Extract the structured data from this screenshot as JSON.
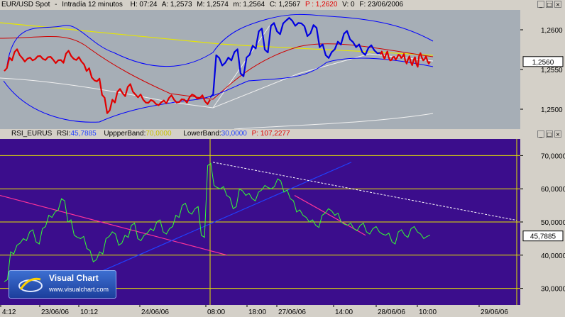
{
  "price_header": {
    "symbol": "EUR/USD Spot",
    "sep1": " - ",
    "interval": "Intradía 12 minutos",
    "H": "H: 07:24",
    "A": "A: 1,2573",
    "M": "M: 1,2574",
    "m": "m: 1,2564",
    "C": "C: 1,2567",
    "P": "P : 1,2620",
    "V": "V: 0",
    "F": "F: 23/06/2006"
  },
  "rsi_header": {
    "name": "RSI_EURUS",
    "rsi_label": "RSI:",
    "rsi_value": "45,7885",
    "upper_label": "UppperBand:",
    "upper_value": "70,0000",
    "lower_label": "LowerBand:",
    "lower_value": "30,0000",
    "p_label": "P: 107,2277"
  },
  "window_buttons": [
    "_",
    "□",
    "×"
  ],
  "colors": {
    "price_bg": "#a6aeb6",
    "rsi_bg": "#3b0d8c",
    "price_red": "#e00000",
    "price_blue": "#0000e0",
    "bollinger": "#0000ff",
    "ma_red": "#d00000",
    "ma_yellow": "#e6e600",
    "rsi_line": "#33ff33",
    "band_yellow": "#e6e600",
    "trend_pink": "#ff3399",
    "trend_blue": "#2040ff",
    "trend_white": "#ffffff"
  },
  "chart_data": [
    {
      "type": "line",
      "ylim": [
        1.2475,
        1.2625
      ],
      "y_ticks": [
        "1,2600",
        "1,2550",
        "1,2500"
      ],
      "last_value_label": "1,2560",
      "last_value": 1.256,
      "series": [
        {
          "values": [
            1.2548,
            1.2565,
            1.2572,
            1.2568,
            1.256,
            1.2565,
            1.2563,
            1.2567,
            1.2562,
            1.2566,
            1.2558,
            1.2562,
            1.257,
            1.2567,
            1.2562,
            1.256,
            1.2548,
            1.254,
            1.2535,
            1.2518,
            1.2495,
            1.2512,
            1.2522,
            1.252,
            1.2528,
            1.2522,
            1.2515,
            1.2512,
            1.2508,
            1.251,
            1.2505,
            1.2511,
            1.2514,
            1.2512,
            1.2509,
            1.2512,
            1.2515,
            1.2517,
            1.2514,
            1.251,
            1.2512
          ]
        },
        {
          "values": [
            1.2515,
            1.2568,
            1.2555,
            1.2565,
            1.2572,
            1.2545,
            1.2565,
            1.258,
            1.2598,
            1.2575,
            1.2605,
            1.2598,
            1.2608,
            1.2615,
            1.2605,
            1.2608,
            1.2592,
            1.2606,
            1.2578,
            1.2568,
            1.2572,
            1.2585,
            1.2595,
            1.2588,
            1.2578,
            1.2572,
            1.2577,
            1.2574,
            1.2571
          ]
        },
        {
          "values": [
            1.2569,
            1.2567,
            1.2569,
            1.2565,
            1.2562,
            1.2566,
            1.2565,
            1.2568,
            1.2566,
            1.2561,
            1.2563,
            1.2559,
            1.2562,
            1.2557,
            1.2567,
            1.2565,
            1.2563,
            1.2561,
            1.256
          ]
        }
      ]
    },
    {
      "type": "line",
      "ylim": [
        25,
        75
      ],
      "y_ticks": [
        "70,0000",
        "60,0000",
        "50,0000",
        "40,0000",
        "30,0000"
      ],
      "bands": [
        70,
        30
      ],
      "last_value_label": "45,7885",
      "last_value": 45.79,
      "series": [
        {
          "values": [
            32,
            41,
            43,
            45,
            47,
            44,
            48,
            52,
            53,
            57,
            50,
            46,
            45,
            42,
            38,
            41,
            45,
            47,
            43,
            46,
            49,
            45,
            46,
            48,
            50,
            47,
            48,
            52,
            55,
            53,
            54,
            46,
            67,
            61,
            60,
            58,
            54,
            60,
            58,
            57,
            59,
            61,
            60,
            63,
            59,
            57,
            53,
            52,
            50,
            49,
            52,
            54,
            52,
            50,
            49,
            48,
            49,
            47,
            48,
            47,
            46,
            44,
            47,
            46,
            48,
            47,
            45,
            46
          ]
        }
      ]
    }
  ],
  "x_axis_labels": [
    "4:12",
    "23/06/06",
    "10:12",
    "24/06/06",
    "08:00",
    "18:00",
    "27/06/06",
    "14:00",
    "28/06/06",
    "10:00",
    "29/06/06"
  ],
  "logo": {
    "title": "Visual Chart",
    "url": "www.visualchart.com"
  }
}
